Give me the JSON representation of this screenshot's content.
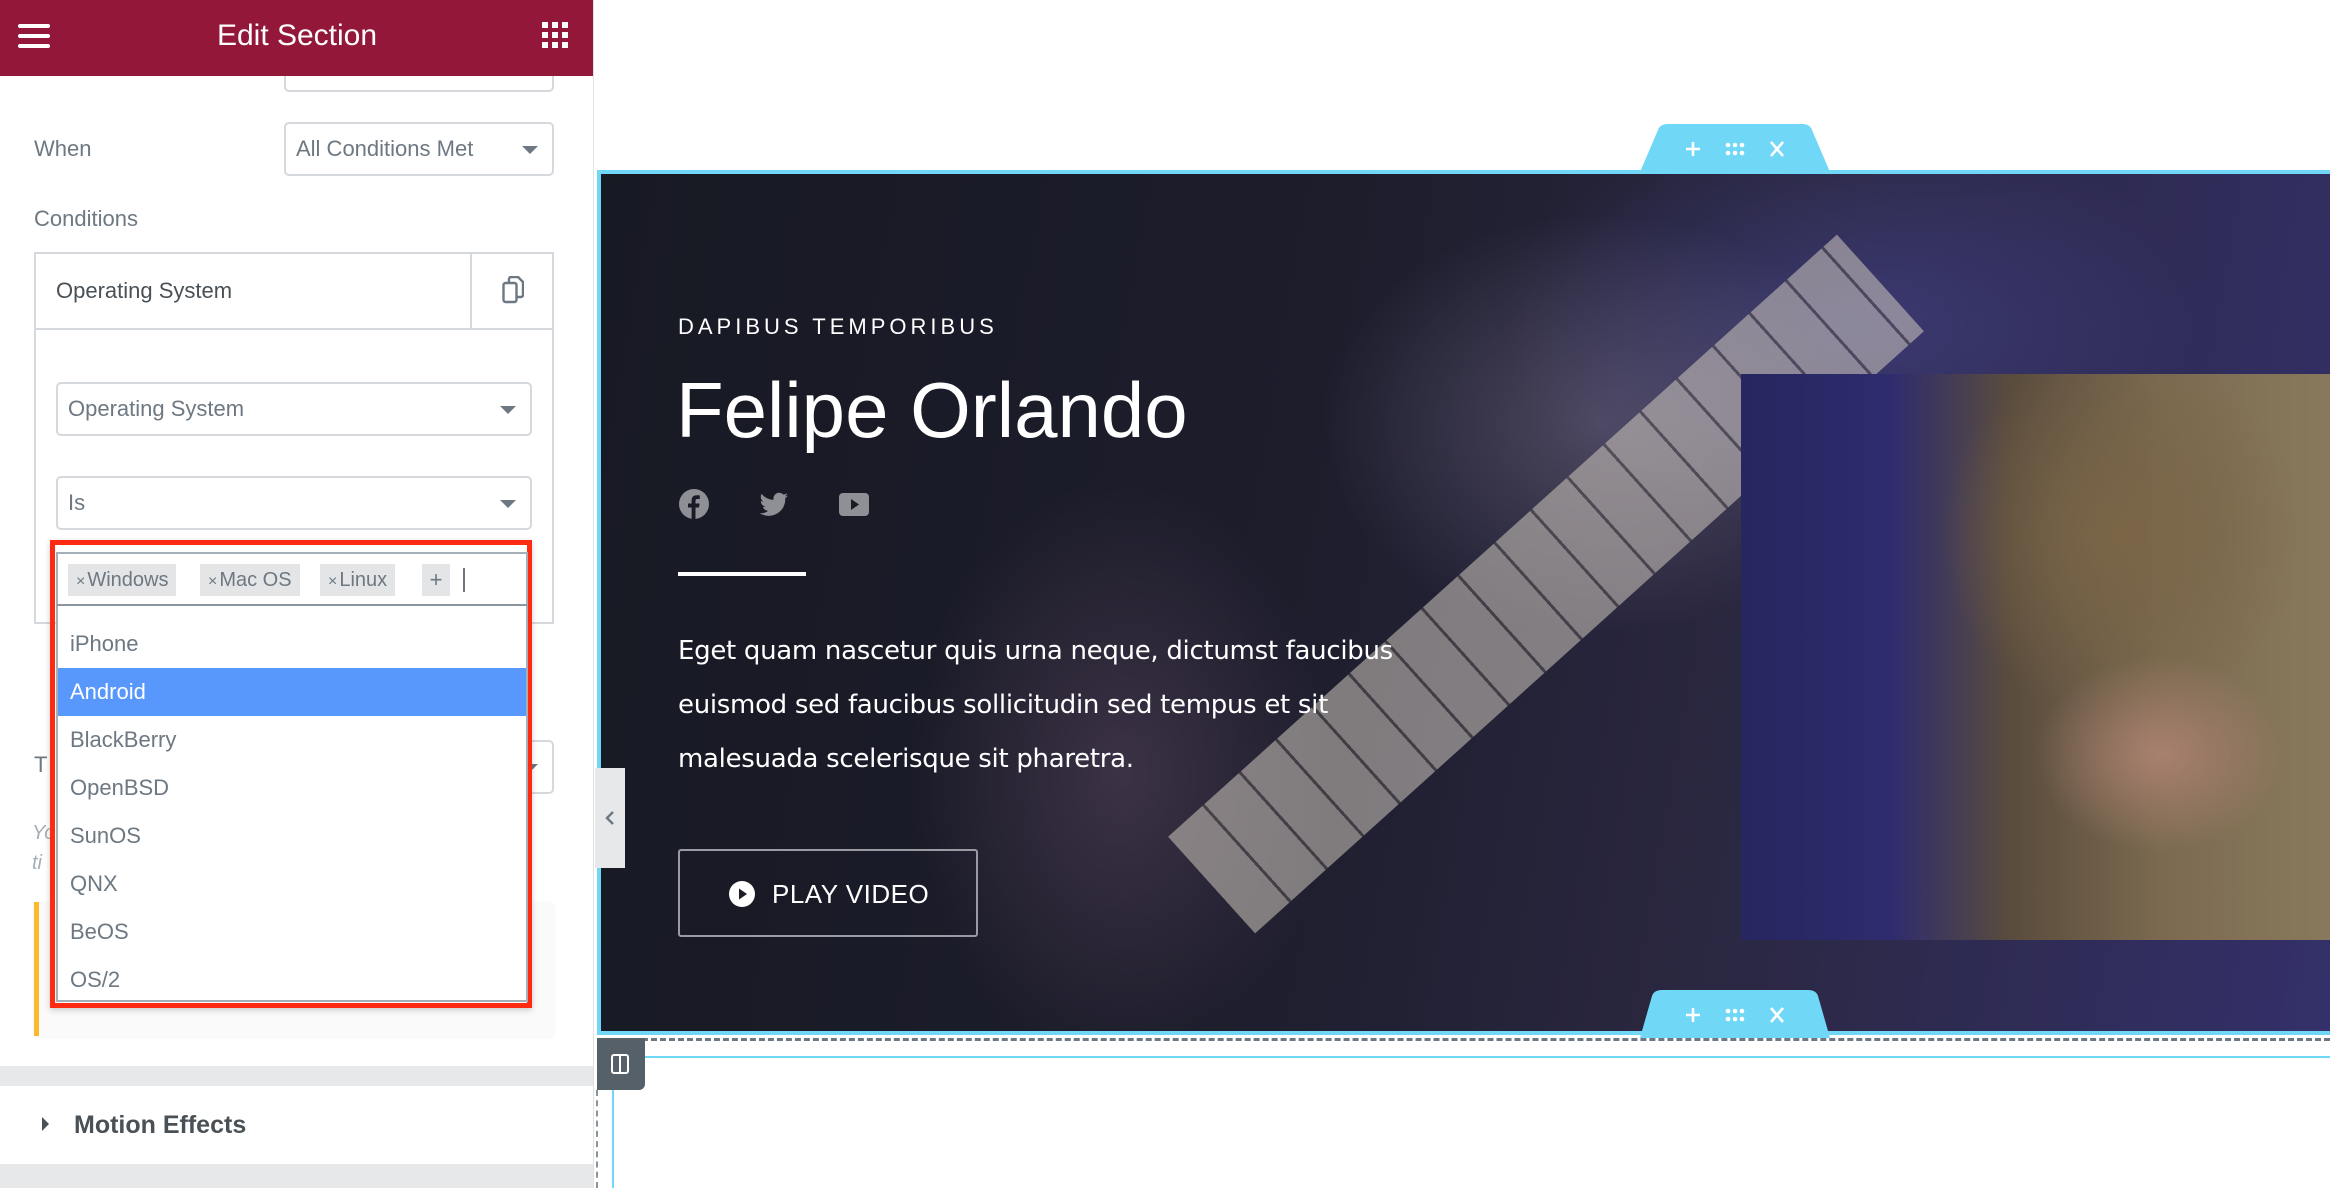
{
  "panel": {
    "title": "Edit Section",
    "when_label": "When",
    "when_value": "All Conditions Met",
    "conditions_label": "Conditions",
    "condition_item": {
      "title": "Operating System",
      "type_value": "Operating System",
      "operator_value": "Is"
    },
    "hidden_label_partial": "T",
    "hidden_note_partial": [
      "Yo",
      "ti"
    ],
    "motion_effects_label": "Motion Effects"
  },
  "dropdown": {
    "selected_tags": [
      "Windows",
      "Mac OS",
      "Linux"
    ],
    "tag_remove_glyph": "×",
    "add_glyph": "+",
    "options": [
      "iPhone",
      "Android",
      "BlackBerry",
      "OpenBSD",
      "SunOS",
      "QNX",
      "BeOS",
      "OS/2"
    ],
    "highlighted_option": "Android"
  },
  "hero": {
    "eyebrow": "DAPIBUS TEMPORIBUS",
    "title": "Felipe Orlando",
    "social_icons": [
      "facebook-icon",
      "twitter-icon",
      "youtube-icon"
    ],
    "body": "Eget quam nascetur quis urna neque, dictumst faucibus euismod sed faucibus sollicitudin sed tempus et sit malesuada scelerisque sit pharetra.",
    "button_label": "PLAY VIDEO"
  },
  "section_handle": {
    "add_glyph": "+",
    "close_glyph": "✕"
  },
  "colors": {
    "header": "#921739",
    "section_outline": "#71d7f7",
    "highlight_option": "#5897fb",
    "annotation_box": "#ff2a12",
    "notice_accent": "#fcb92c"
  }
}
